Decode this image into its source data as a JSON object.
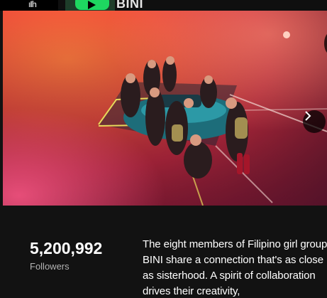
{
  "artist": {
    "name": "BINI"
  },
  "top_strip": {
    "icon": "equalizer-bars-icon",
    "play_icon": "play-icon",
    "accent_color": "#1ed760"
  },
  "hero": {
    "image_desc": "promo-photo",
    "next_icon": "chevron-right-icon"
  },
  "stats": {
    "followers_count": "5,200,992",
    "followers_label": "Followers"
  },
  "bio": {
    "text": "The eight members of Filipino girl group BINI share a connection that's as close as sisterhood. A spirit of collaboration drives their creativity,"
  }
}
